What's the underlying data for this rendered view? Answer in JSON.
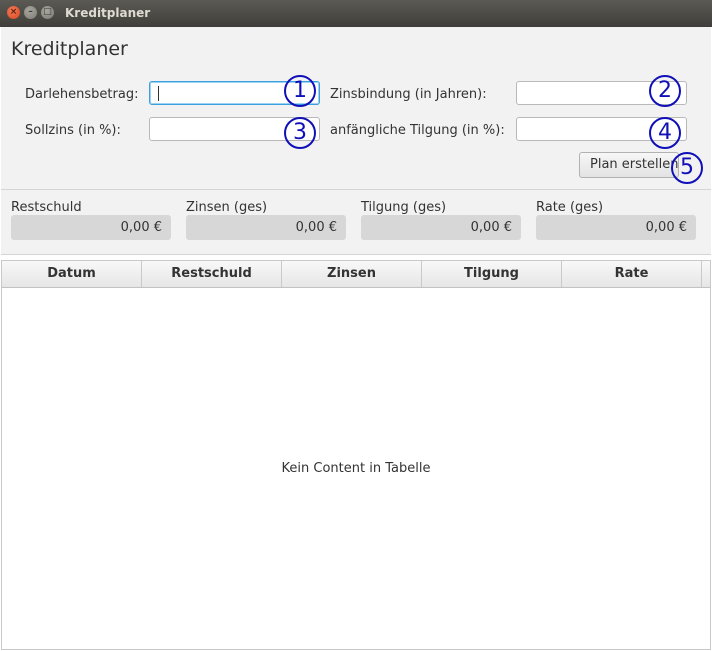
{
  "window": {
    "title": "Kreditplaner",
    "close_glyph": "×",
    "min_glyph": "–",
    "max_glyph": "□"
  },
  "form": {
    "title": "Kreditplaner",
    "labels": {
      "darlehensbetrag": "Darlehensbetrag:",
      "zinsbindung": "Zinsbindung (in Jahren):",
      "sollzins": "Sollzins (in %):",
      "tilgung": "anfängliche Tilgung (in %):"
    },
    "values": {
      "darlehensbetrag": "",
      "zinsbindung": "",
      "sollzins": "",
      "tilgung": ""
    },
    "button_label": "Plan erstellen",
    "markers": [
      "1",
      "2",
      "3",
      "4",
      "5"
    ]
  },
  "summary": {
    "restschuld": {
      "label": "Restschuld",
      "value": "0,00 €"
    },
    "zinsen": {
      "label": "Zinsen (ges)",
      "value": "0,00 €"
    },
    "tilgung": {
      "label": "Tilgung (ges)",
      "value": "0,00 €"
    },
    "rate": {
      "label": "Rate (ges)",
      "value": "0,00 €"
    }
  },
  "table": {
    "columns": [
      "Datum",
      "Restschuld",
      "Zinsen",
      "Tilgung",
      "Rate"
    ],
    "empty_text": "Kein Content in Tabelle"
  },
  "colors": {
    "accent_focus": "#3aa0e0",
    "marker": "#1010b8",
    "close_button": "#e1552b"
  }
}
